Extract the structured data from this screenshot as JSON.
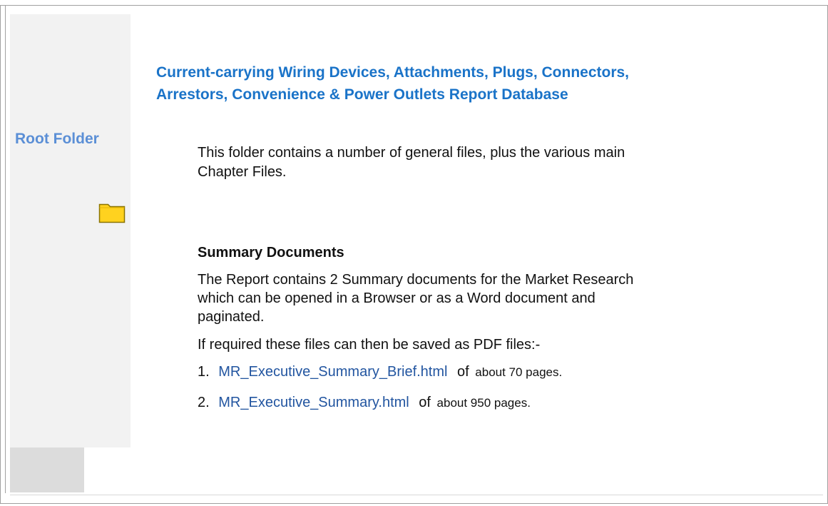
{
  "title": {
    "line1": "Current-carrying Wiring Devices, Attachments, Plugs, Connectors,",
    "line2": "Arrestors, Convenience & Power Outlets Report Database"
  },
  "sidebar": {
    "label": "Root Folder",
    "icon": "folder-icon",
    "colors": {
      "label": "#5b8fd6",
      "folder_fill": "#ffd21f",
      "folder_stroke": "#8a7400"
    }
  },
  "content": {
    "folder_desc": "This folder contains a number of general files, plus the various main Chapter Files.",
    "summary_heading": "Summary Documents",
    "summary_desc": "The Report contains 2 Summary documents for the Market Research which can be opened in a Browser or as a Word document and paginated.",
    "pdf_note": "If required these files can then be saved as PDF files:-",
    "documents": [
      {
        "number": "1.",
        "link": "MR_Executive_Summary_Brief.html",
        "pages_prefix": "of",
        "pages": "about 70 pages."
      },
      {
        "number": "2.",
        "link": "MR_Executive_Summary.html",
        "pages_prefix": "of",
        "pages": "about 950 pages."
      }
    ]
  }
}
